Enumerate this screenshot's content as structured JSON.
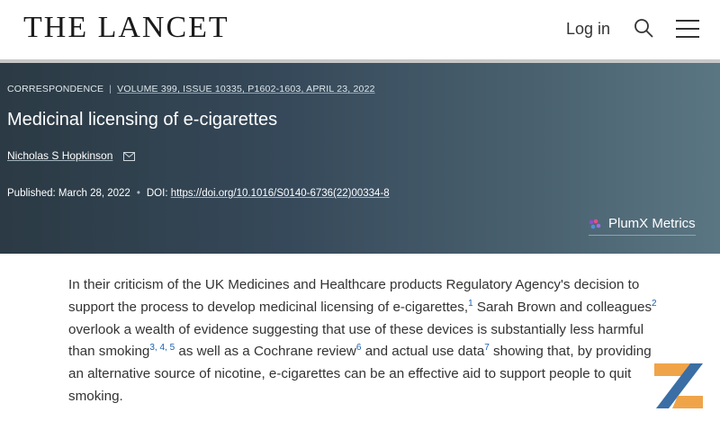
{
  "header": {
    "logo": "THE LANCET",
    "login_label": "Log in"
  },
  "article": {
    "type": "CORRESPONDENCE",
    "volume": "VOLUME 399, ISSUE 10335, P1602-1603, APRIL 23, 2022",
    "title": "Medicinal licensing of e-cigarettes",
    "author": "Nicholas S Hopkinson",
    "published_label": "Published:",
    "published_date": "March 28, 2022",
    "doi_label": "DOI:",
    "doi": "https://doi.org/10.1016/S0140-6736(22)00334-8",
    "plumx_label": "PlumX Metrics"
  },
  "body": {
    "t1": "In their criticism of the UK Medicines and Healthcare products Regulatory Agency's decision to support the process to develop medicinal licensing of e-cigarettes,",
    "r1": "1",
    "t2": " Sarah Brown and colleagues",
    "r2": "2",
    "t3": " overlook a wealth of evidence suggesting that use of these devices is substantially less harmful than smoking",
    "r3": "3, 4, 5",
    "t4": " as well as a Cochrane review",
    "r6": "6",
    "t5": " and actual use data",
    "r7": "7",
    "t6": " showing that, by providing an alternative source of nicotine, e-cigarettes can be an effective aid to support people to quit smoking."
  },
  "colors": {
    "hero_start": "#2b3a44",
    "hero_end": "#5b7683",
    "link_blue": "#1a5fb4",
    "watermark_orange": "#f0a44a",
    "watermark_blue": "#3a6ea5"
  }
}
